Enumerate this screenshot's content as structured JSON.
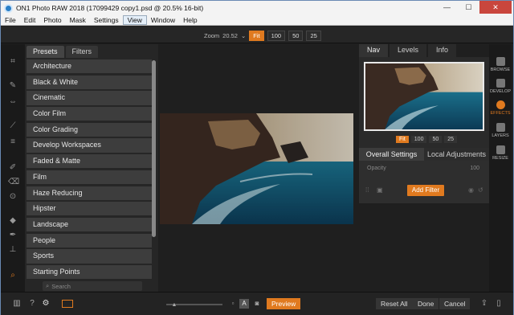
{
  "window": {
    "title": "ON1 Photo RAW 2018 (17099429 copy1.psd @ 20.5% 16-bit)",
    "controls": [
      "—",
      "☐",
      "✕"
    ]
  },
  "menu": [
    "File",
    "Edit",
    "Photo",
    "Mask",
    "Settings",
    "View",
    "Window",
    "Help"
  ],
  "menu_selected": "View",
  "toolbar": {
    "zoom_label": "Zoom",
    "zoom_value": "20.52",
    "zoom_buttons": [
      "Fit",
      "100",
      "50",
      "25"
    ],
    "zoom_active": "Fit"
  },
  "presets_panel": {
    "tabs": [
      "Presets",
      "Filters"
    ],
    "active_tab": "Presets",
    "items": [
      "Architecture",
      "Black & White",
      "Cinematic",
      "Color Film",
      "Color Grading",
      "Develop Workspaces",
      "Faded & Matte",
      "Film",
      "Haze Reducing",
      "Hipster",
      "Landscape",
      "People",
      "Sports",
      "Starting Points"
    ],
    "search_placeholder": "Search"
  },
  "right_panel": {
    "tabs": [
      "Nav",
      "Levels",
      "Info"
    ],
    "active_tab": "Nav",
    "nav_zoom": [
      "Fit",
      "100",
      "50",
      "25"
    ],
    "nav_zoom_active": "Fit",
    "settings_tabs": [
      "Overall Settings",
      "Local Adjustments"
    ],
    "settings_active": "Overall Settings",
    "opacity_label": "Opacity",
    "opacity_value": "100",
    "add_filter_label": "Add Filter"
  },
  "module_bar": [
    {
      "label": "BROWSE",
      "icon": "browse-icon"
    },
    {
      "label": "DEVELOP",
      "icon": "develop-icon"
    },
    {
      "label": "EFFECTS",
      "icon": "effects-icon",
      "active": true
    },
    {
      "label": "LAYERS",
      "icon": "layers-icon"
    },
    {
      "label": "RESIZE",
      "icon": "resize-icon"
    }
  ],
  "bottom": {
    "preview_label": "Preview",
    "reset_all_label": "Reset All",
    "done_label": "Done",
    "cancel_label": "Cancel",
    "view_mode_a": "A"
  },
  "colors": {
    "accent": "#e07a1f",
    "panel": "#262626",
    "item": "#3d3d3d"
  }
}
